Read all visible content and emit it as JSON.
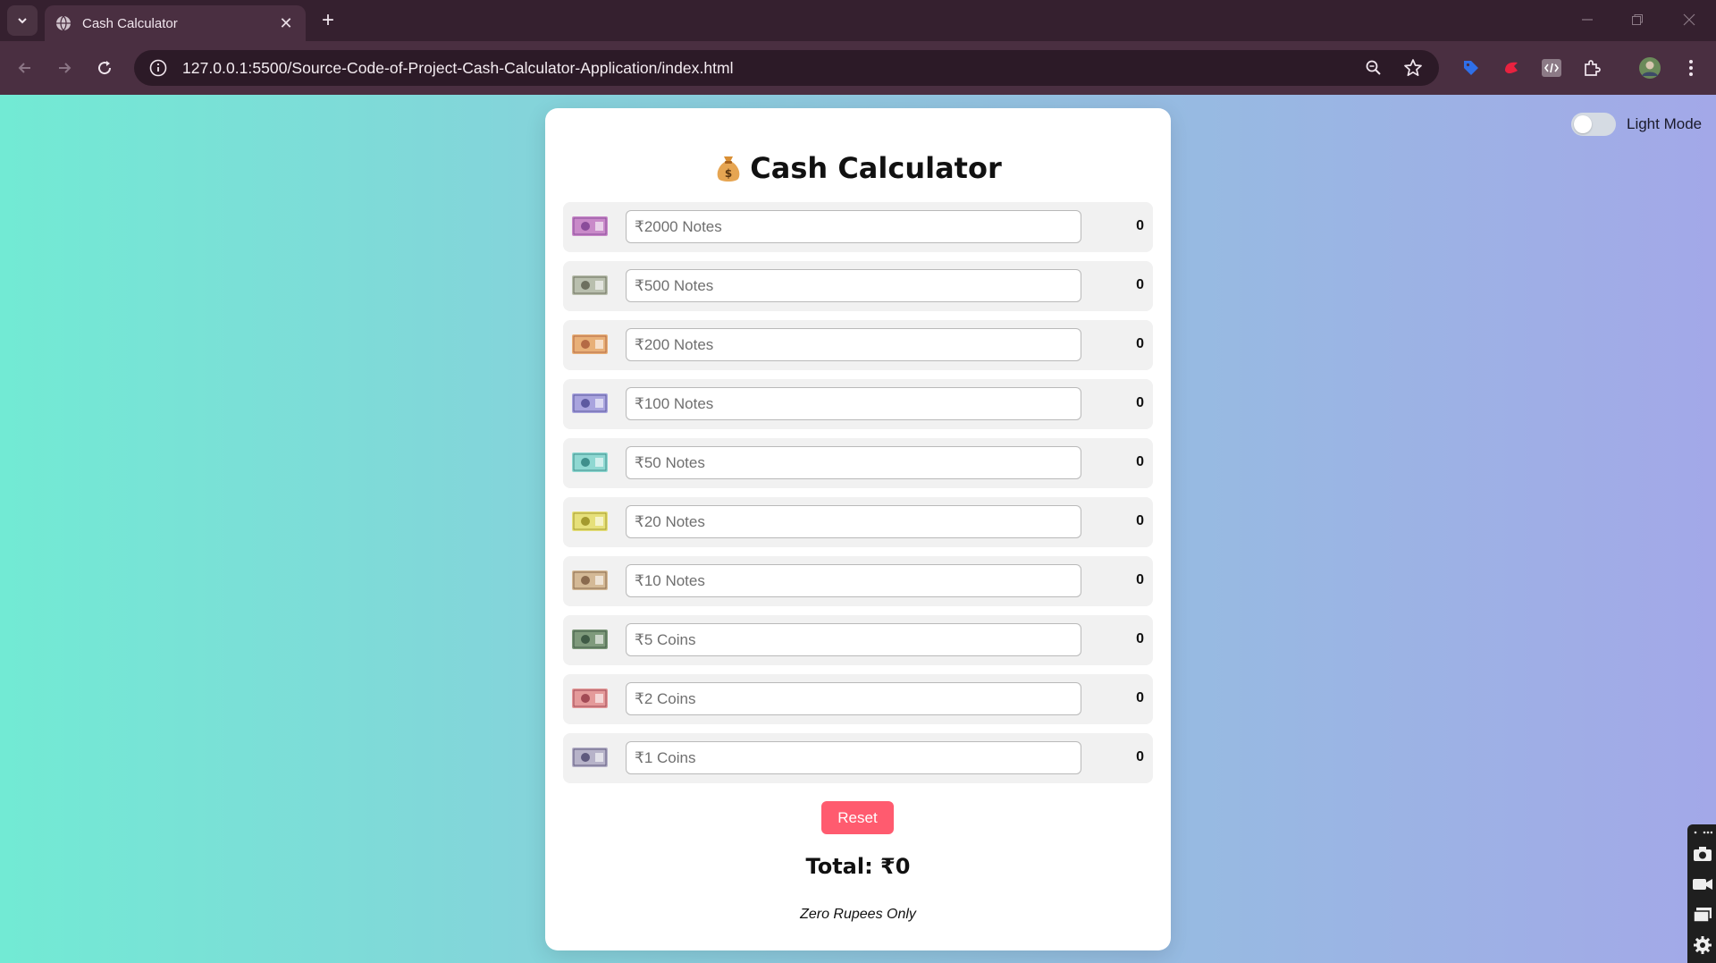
{
  "browser": {
    "tab_title": "Cash Calculator",
    "url": "127.0.0.1:5500/Source-Code-of-Project-Cash-Calculator-Application/index.html",
    "new_tab_label": "+",
    "close_tab_label": "✕"
  },
  "page": {
    "mode_label": "Light Mode",
    "title": "Cash Calculator",
    "title_icon": "money-bag-icon",
    "rows": [
      {
        "placeholder": "₹2000 Notes",
        "amount": "0",
        "note_color": "#c98ac9",
        "accent": "#8a4c9a"
      },
      {
        "placeholder": "₹500 Notes",
        "amount": "0",
        "note_color": "#b9bfae",
        "accent": "#6d705f"
      },
      {
        "placeholder": "₹200 Notes",
        "amount": "0",
        "note_color": "#e8b078",
        "accent": "#b46a45"
      },
      {
        "placeholder": "₹100 Notes",
        "amount": "0",
        "note_color": "#a9a4de",
        "accent": "#5d5aa0"
      },
      {
        "placeholder": "₹50 Notes",
        "amount": "0",
        "note_color": "#8fd8d2",
        "accent": "#3f8f8c"
      },
      {
        "placeholder": "₹20 Notes",
        "amount": "0",
        "note_color": "#e6e07a",
        "accent": "#a49a2e"
      },
      {
        "placeholder": "₹10 Notes",
        "amount": "0",
        "note_color": "#d4b996",
        "accent": "#8a6a4e"
      },
      {
        "placeholder": "₹5 Coins",
        "amount": "0",
        "note_color": "#7f9a7c",
        "accent": "#3f5a45"
      },
      {
        "placeholder": "₹2 Coins",
        "amount": "0",
        "note_color": "#e49a9a",
        "accent": "#a24a55"
      },
      {
        "placeholder": "₹1 Coins",
        "amount": "0",
        "note_color": "#b7b3c9",
        "accent": "#5f5a7e"
      }
    ],
    "reset_label": "Reset",
    "total_text": "Total: ₹0",
    "amount_in_words": "Zero Rupees Only"
  },
  "colors": {
    "accent": "#ff5b6f",
    "gradient_start": "#72ead4",
    "gradient_end": "#a3a8e8"
  }
}
